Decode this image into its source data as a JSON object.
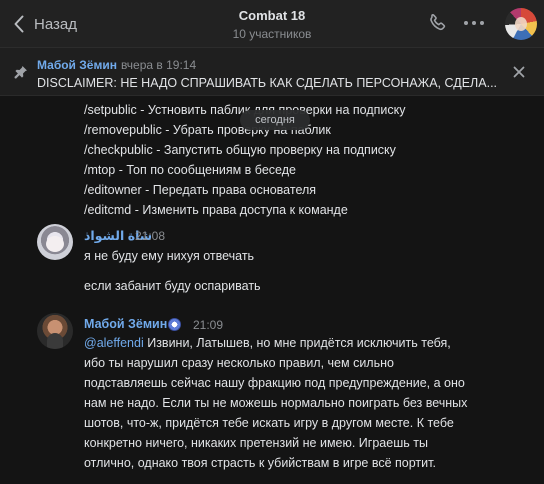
{
  "header": {
    "back_label": "Назад",
    "title": "Combat 18",
    "subtitle": "10 участников",
    "icons": [
      "chevron-left-icon",
      "phone-icon",
      "more-icon"
    ]
  },
  "pinned": {
    "author": "Мабой Зёмин",
    "date": "вчера в 19:14",
    "text": "DISCLAIMER: НЕ НАДО СПРАШИВАТЬ КАК СДЕЛАТЬ ПЕРСОНАЖА, СДЕЛА...",
    "icons": [
      "pin-icon",
      "close-icon"
    ]
  },
  "day_separator": "сегодня",
  "commands": [
    "/setpublic - Устновить паблик для проверки на подписку",
    "/removepublic - Убрать проверку на паблик",
    "/checkpublic - Запустить общую проверку на подписку",
    "/mtop - Топ по сообщениям в беседе",
    "/editowner - Передать права основателя",
    "/editcmd - Изменить права доступа к команде"
  ],
  "messages": [
    {
      "author": "شاة الشواذ",
      "time": "21:08",
      "lines": [
        "я не буду ему нихуя отвечать",
        "если забанит буду оспаривать"
      ]
    },
    {
      "author": "Мабой Зёмин",
      "time": "21:09",
      "mention": "@aleffendi",
      "body": " Извини, Латышев, но мне придётся исключить тебя, ибо ты нарушил сразу несколько правил, чем сильно подставляешь сейчас нашу фракцию под предупреждение, а оно нам не надо. Если ты не можешь нормально поиграть без вечных шотов, что-ж, придётся тебе искать игру в другом месте. К тебе конкретно ничего, никаких претензий не имею. Играешь ты отлично, однако твоя страсть к убийствам в игре всё портит."
    }
  ],
  "colors": {
    "background": "#141414",
    "header": "#222222",
    "accent": "#71aaeb",
    "muted": "#8a8d91",
    "text": "#e1e3e6"
  }
}
